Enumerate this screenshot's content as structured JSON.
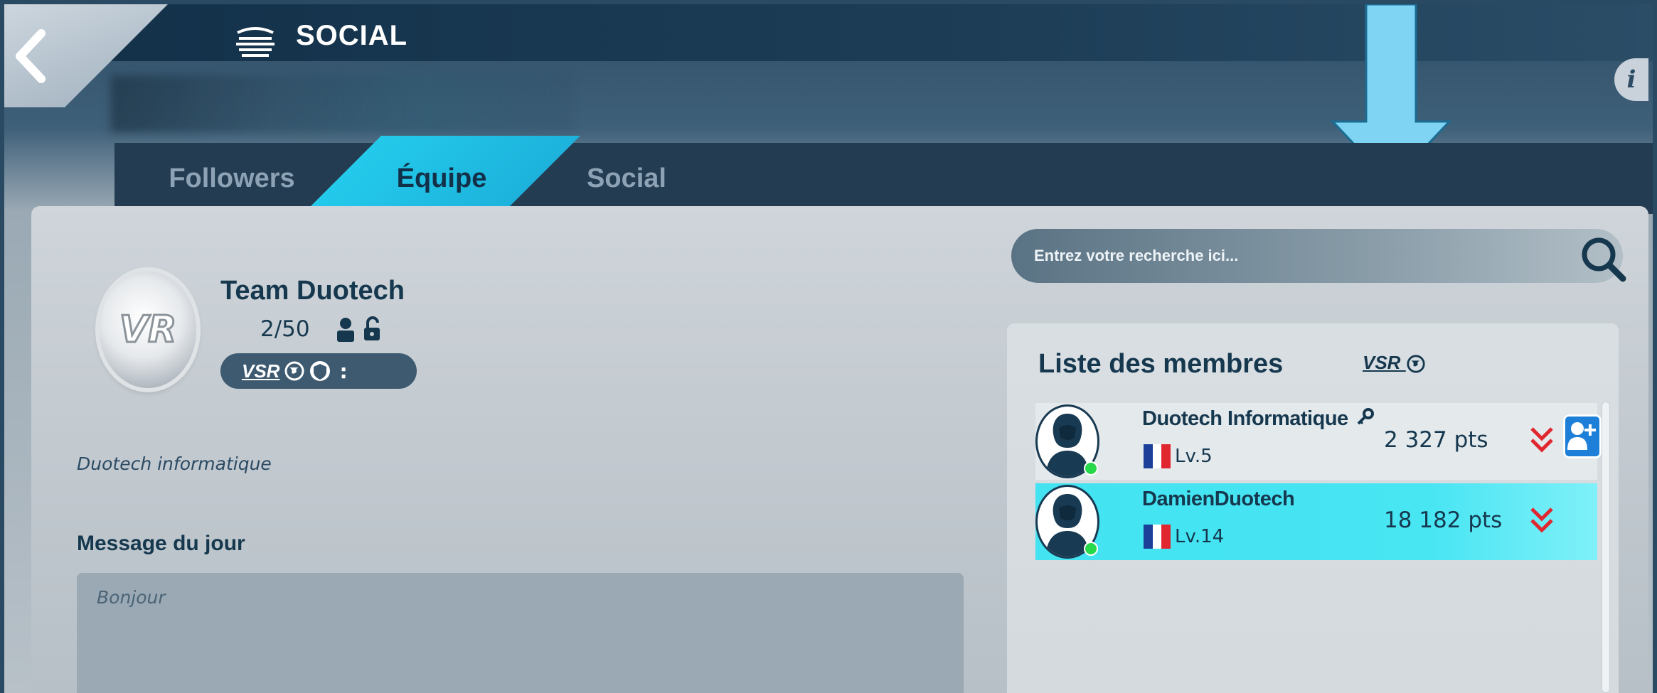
{
  "header": {
    "title": "SOCIAL",
    "back_icon": "chevron-left-icon",
    "title_icon": "ship-icon",
    "info_label": "i"
  },
  "annotation": {
    "arrow_icon": "down-arrow-icon",
    "color": "#7fd4f4"
  },
  "tabs": [
    {
      "label": "Followers",
      "active": false
    },
    {
      "label": "Équipe",
      "active": true
    },
    {
      "label": "Social",
      "active": false
    }
  ],
  "team": {
    "logo_text": "VR",
    "name": "Team Duotech",
    "count": "2/50",
    "badge_vsr": "VSR",
    "badge_suffix": ":",
    "description": "Duotech informatique",
    "motd_label": "Message du jour",
    "motd_text": "Bonjour"
  },
  "search": {
    "placeholder": "Entrez votre recherche ici..."
  },
  "members": {
    "title": "Liste des membres",
    "vsr_label": "VSR",
    "list": [
      {
        "name": "Duotech Informatique",
        "level": "Lv.5",
        "points": "2 327 pts",
        "key": true,
        "highlighted": false
      },
      {
        "name": "DamienDuotech",
        "level": "Lv.14",
        "points": "18 182 pts",
        "key": false,
        "highlighted": true
      }
    ]
  },
  "colors": {
    "accent": "#26d3f0",
    "dark_text": "#16384f",
    "tab_inactive": "#8da3b5",
    "chevron_red": "#e0262e",
    "add_blue": "#1e7fd8"
  }
}
